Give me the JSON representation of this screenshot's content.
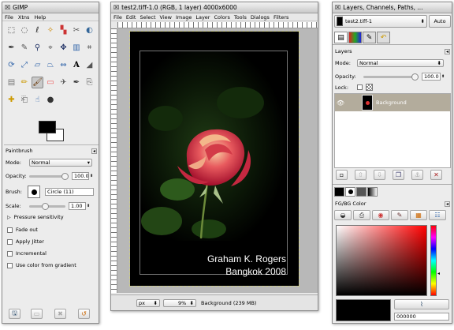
{
  "toolbox": {
    "title": "GIMP",
    "menu": [
      "File",
      "Xtns",
      "Help"
    ],
    "tool_options_title": "Paintbrush",
    "mode_label": "Mode:",
    "mode_value": "Normal",
    "opacity_label": "Opacity:",
    "opacity_value": "100.0",
    "opacity_level": 1.0,
    "brush_label": "Brush:",
    "brush_value": "Circle (11)",
    "scale_label": "Scale:",
    "scale_value": "1.00",
    "pressure_label": "Pressure sensitivity",
    "options": [
      "Fade out",
      "Apply Jitter",
      "Incremental",
      "Use color from gradient"
    ],
    "fg_color": "#000000",
    "bg_color": "#ffffff",
    "tools": [
      "rect-select",
      "ellipse-select",
      "free-select",
      "fuzzy-select",
      "by-color-select",
      "scissors",
      "foreground-select",
      "paths",
      "color-picker",
      "zoom",
      "measure",
      "move",
      "align",
      "crop",
      "rotate",
      "scale",
      "shear",
      "perspective",
      "flip",
      "text",
      "bucket-fill",
      "blend",
      "pencil",
      "paintbrush",
      "eraser",
      "airbrush",
      "ink",
      "clone",
      "heal",
      "perspective-clone",
      "smudge",
      "dodge-burn"
    ]
  },
  "image_window": {
    "title": "test2.tiff-1.0 (RGB, 1 layer) 4000x6000",
    "menu": [
      "File",
      "Edit",
      "Select",
      "View",
      "Image",
      "Layer",
      "Colors",
      "Tools",
      "Dialogs",
      "Filters"
    ],
    "caption_line1": "Graham K. Rogers",
    "caption_line2": "Bangkok 2008",
    "unit": "px",
    "zoom": "9%",
    "status": "Background (239 MB)"
  },
  "docks": {
    "title": "Layers, Channels, Paths, ...",
    "image_select": "test2.tiff-1",
    "auto_label": "Auto",
    "layers_title": "Layers",
    "mode_label": "Mode:",
    "mode_value": "Normal",
    "opacity_label": "Opacity:",
    "opacity_value": "100.0",
    "opacity_level": 1.0,
    "lock_label": "Lock:",
    "layer_name": "Background",
    "fgbg_title": "FG/BG Color",
    "hex_value": "000000"
  }
}
